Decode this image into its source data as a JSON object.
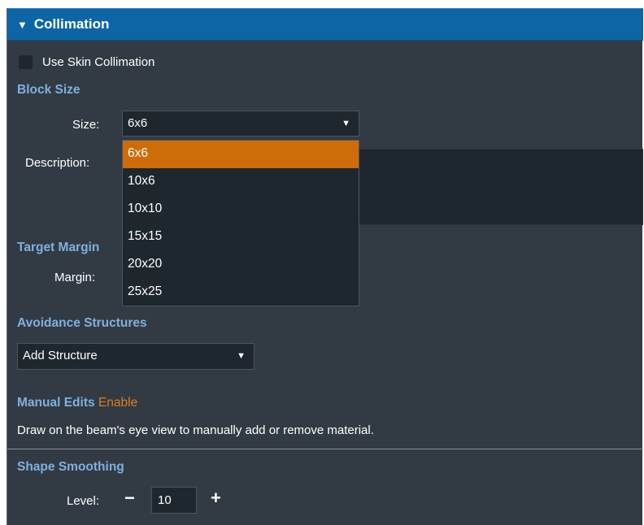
{
  "header": {
    "collapse_glyph": "▼",
    "title": "Collimation"
  },
  "skin_collimation": {
    "label": "Use Skin Collimation",
    "checked": false
  },
  "block_size": {
    "title": "Block Size",
    "size_label": "Size:",
    "size_value": "6x6",
    "description_label": "Description:",
    "options": [
      "6x6",
      "10x6",
      "10x10",
      "15x15",
      "20x20",
      "25x25"
    ],
    "selected_option": "6x6"
  },
  "target_margin": {
    "title": "Target Margin",
    "margin_label": "Margin:"
  },
  "avoidance": {
    "title": "Avoidance Structures",
    "select_value": "Add Structure"
  },
  "manual_edits": {
    "title": "Manual Edits",
    "action": "Enable",
    "help": "Draw on the beam's eye view to manually add or remove material."
  },
  "shape_smoothing": {
    "title": "Shape Smoothing",
    "level_label": "Level:",
    "minus": "−",
    "value": "10",
    "plus": "+"
  },
  "colors": {
    "header_bg": "#0e65a6",
    "panel_bg": "#323b43",
    "section_text": "#7fb0e2",
    "selected_option": "#cd6c09",
    "link": "#e07a1f"
  },
  "icons": [
    "collapse-triangle-icon",
    "dropdown-arrow-icon",
    "minus-icon",
    "plus-icon"
  ]
}
